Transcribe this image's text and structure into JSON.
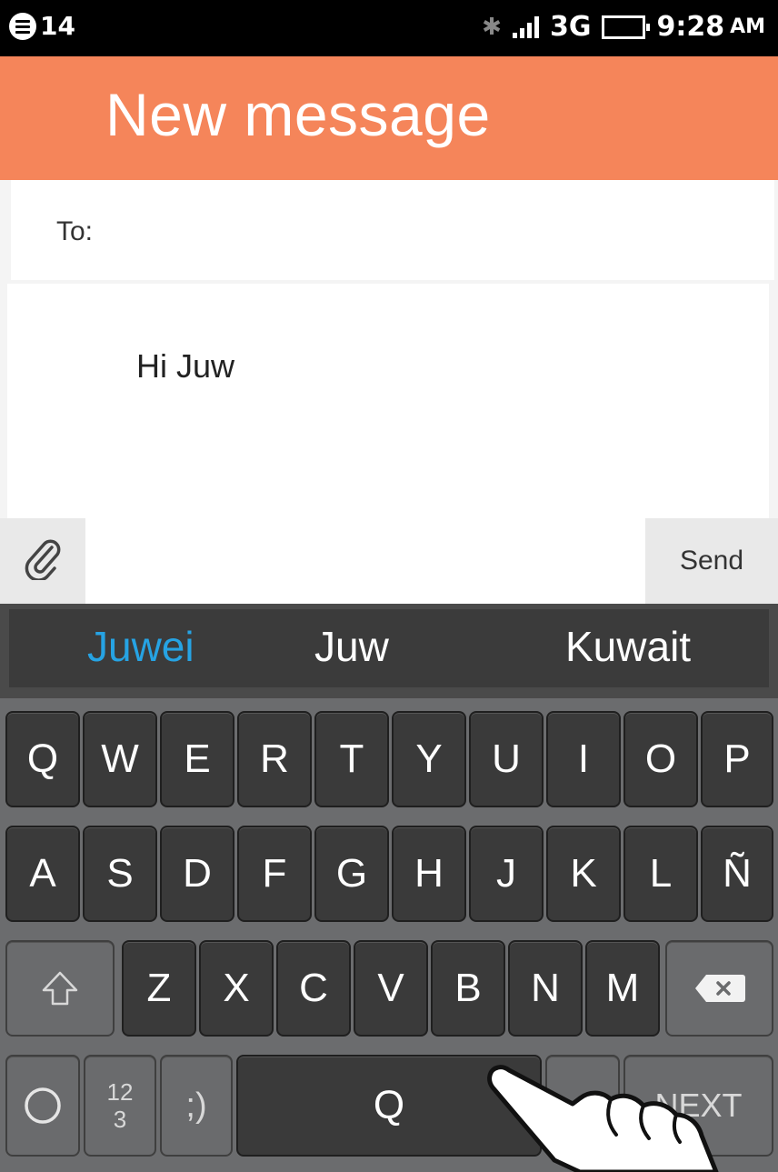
{
  "status_bar": {
    "notification_count": "14",
    "network": "3G",
    "time": "9:28",
    "ampm": "AM"
  },
  "header": {
    "title": "New message"
  },
  "compose": {
    "to_label": "To:",
    "message_text": "Hi Juw",
    "send_label": "Send"
  },
  "keyboard": {
    "suggestions": [
      "Juwei",
      "Juw",
      "Kuwait"
    ],
    "row1": [
      "Q",
      "W",
      "E",
      "R",
      "T",
      "Y",
      "U",
      "I",
      "O",
      "P"
    ],
    "row2": [
      "A",
      "S",
      "D",
      "F",
      "G",
      "H",
      "J",
      "K",
      "L",
      "Ñ"
    ],
    "row3": [
      "Z",
      "X",
      "C",
      "V",
      "B",
      "N",
      "M"
    ],
    "numbers_key": [
      "12",
      "3"
    ],
    "emoji_key": ";)",
    "space_key": "Q",
    "next_key": "NEXT"
  },
  "colors": {
    "header": "#f5855a",
    "suggestion_active": "#26a3e3",
    "keyboard_bg": "#6b6c6e",
    "key_bg": "#3a3a3a"
  }
}
